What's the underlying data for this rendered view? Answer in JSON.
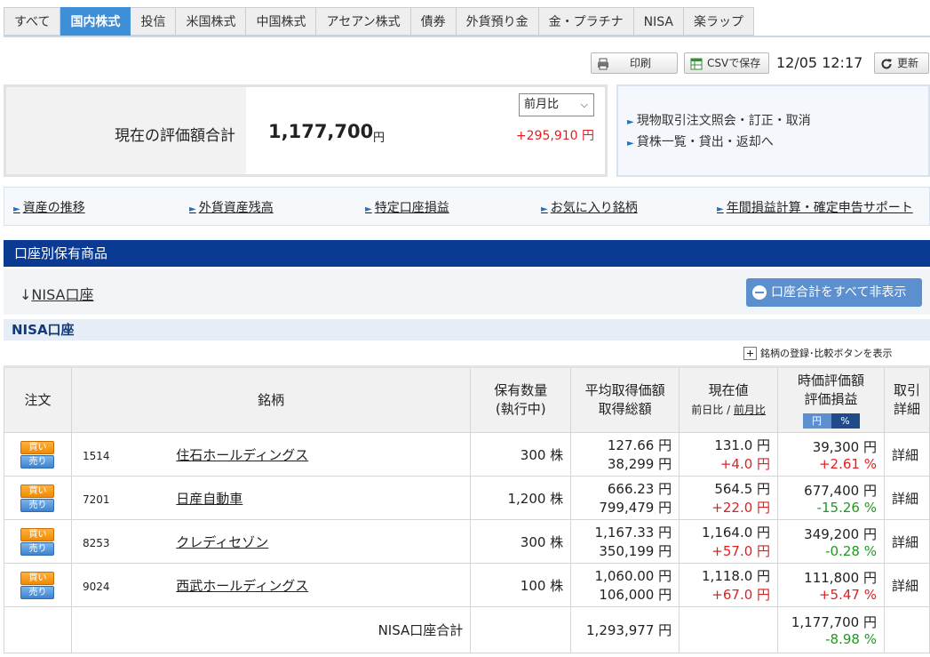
{
  "tabs": [
    "すべて",
    "国内株式",
    "投信",
    "米国株式",
    "中国株式",
    "アセアン株式",
    "債券",
    "外貨預り金",
    "金・プラチナ",
    "NISA",
    "楽ラップ"
  ],
  "active_tab": "国内株式",
  "toolbar": {
    "print_label": "印刷",
    "csv_label": "CSVで保存",
    "timestamp": "12/05 12:17",
    "refresh_label": "更新"
  },
  "summary": {
    "label": "現在の評価額合計",
    "value": "1,177,700",
    "unit": "円",
    "compare_select": "前月比",
    "diff": "+295,910 円"
  },
  "right_links": [
    "現物取引注文照会・訂正・取消",
    "貸株一覧・貸出・返却へ"
  ],
  "link_bar": [
    "資産の推移",
    "外貨資産残高",
    "特定口座損益",
    "お気に入り銘柄",
    "年間損益計算・確定申告サポート"
  ],
  "section_title": "口座別保有商品",
  "account_link_arrow": "↓",
  "account_link": "NISA口座",
  "hide_button": "口座合計をすべて非表示",
  "subsection_title": "NISA口座",
  "add_compare_button": "銘柄の登録･比較ボタンを表示",
  "table": {
    "headers": {
      "order": "注文",
      "name": "銘柄",
      "qty1": "保有数量",
      "qty2": "(執行中)",
      "avg1": "平均取得価額",
      "avg2": "取得総額",
      "cur1": "現在値",
      "cur_day": "前日比",
      "cur_sep": " / ",
      "cur_month": "前月比",
      "val1": "時価評価額",
      "val2": "評価損益",
      "toggle_yen": "円",
      "toggle_pct": "%",
      "detail1": "取引",
      "detail2": "詳細"
    },
    "buy_label": "買い",
    "sell_label": "売り",
    "rows": [
      {
        "code": "1514",
        "name": "住石ホールディングス",
        "qty": "300 株",
        "avg_price": "127.66 円",
        "avg_total": "38,299 円",
        "cur_price": "131.0 円",
        "cur_change": "+4.0 円",
        "value": "39,300 円",
        "pl": "+2.61 %",
        "pl_sign": "pos",
        "detail": "詳細"
      },
      {
        "code": "7201",
        "name": "日産自動車",
        "qty": "1,200 株",
        "avg_price": "666.23 円",
        "avg_total": "799,479 円",
        "cur_price": "564.5 円",
        "cur_change": "+22.0 円",
        "value": "677,400 円",
        "pl": "-15.26 %",
        "pl_sign": "neg",
        "detail": "詳細"
      },
      {
        "code": "8253",
        "name": "クレディセゾン",
        "qty": "300 株",
        "avg_price": "1,167.33 円",
        "avg_total": "350,199 円",
        "cur_price": "1,164.0 円",
        "cur_change": "+57.0 円",
        "value": "349,200 円",
        "pl": "-0.28 %",
        "pl_sign": "neg",
        "detail": "詳細"
      },
      {
        "code": "9024",
        "name": "西武ホールディングス",
        "qty": "100 株",
        "avg_price": "1,060.00 円",
        "avg_total": "106,000 円",
        "cur_price": "1,118.0 円",
        "cur_change": "+67.0 円",
        "value": "111,800 円",
        "pl": "+5.47 %",
        "pl_sign": "pos",
        "detail": "詳細"
      }
    ],
    "total": {
      "label": "NISA口座合計",
      "acquired": "1,293,977 円",
      "value": "1,177,700 円",
      "pl": "-8.98 %"
    }
  },
  "colors": {
    "tab_active": "#3f8ed8",
    "section_header": "#0a3a92",
    "positive": "#e02020",
    "negative": "#1f9a1f",
    "buy": "#ef8a06",
    "sell": "#3f83cf"
  }
}
